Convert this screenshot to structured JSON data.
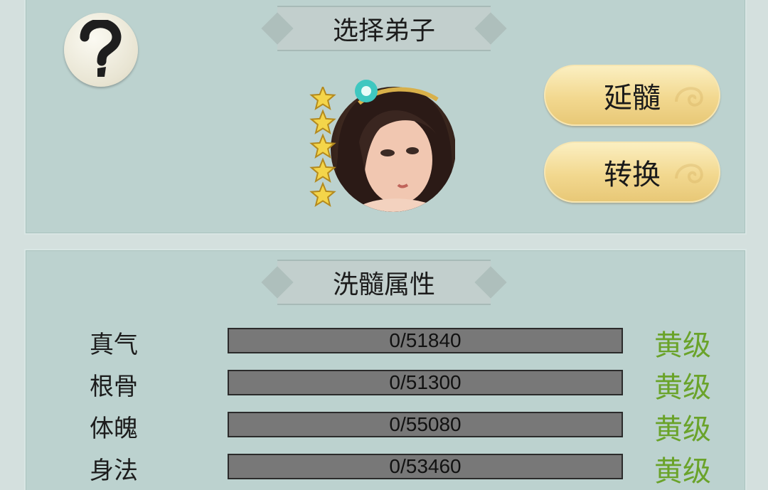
{
  "header": {
    "title": "选择弟子",
    "help_icon": "question-mark-icon"
  },
  "disciple": {
    "stars": 5,
    "portrait": "disciple-portrait"
  },
  "actions": {
    "extend_label": "延髓",
    "convert_label": "转换"
  },
  "attributes": {
    "title": "洗髓属性",
    "rows": [
      {
        "label": "真气",
        "current": 0,
        "max": 51840,
        "value_text": "0/51840",
        "grade": "黄级",
        "progress": 0
      },
      {
        "label": "根骨",
        "current": 0,
        "max": 51300,
        "value_text": "0/51300",
        "grade": "黄级",
        "progress": 0
      },
      {
        "label": "体魄",
        "current": 0,
        "max": 55080,
        "value_text": "0/55080",
        "grade": "黄级",
        "progress": 0
      },
      {
        "label": "身法",
        "current": 0,
        "max": 53460,
        "value_text": "0/53460",
        "grade": "黄级",
        "progress": 0
      }
    ]
  },
  "colors": {
    "background": "#bcd2cf",
    "grade": "#6aa32a",
    "button": "#f2d88f",
    "bar": "#787878"
  }
}
